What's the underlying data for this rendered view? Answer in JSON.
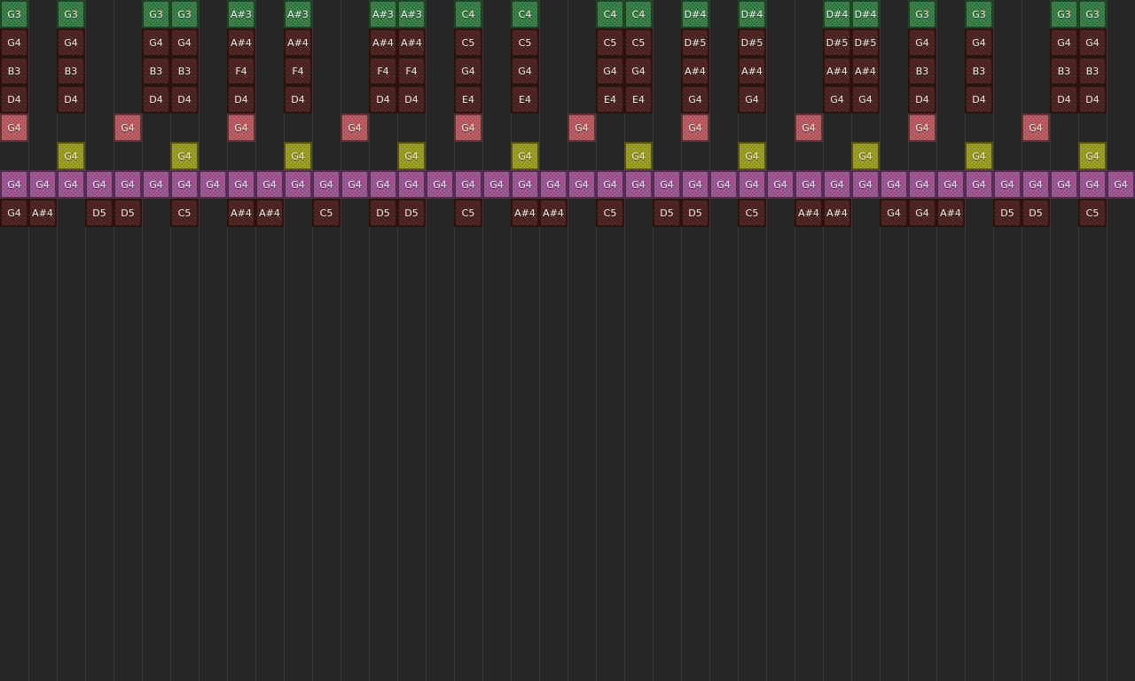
{
  "colors": {
    "background": "#262628",
    "divider": "#3c3c3e",
    "bass": "#2f7a3d",
    "chord": "#4a1e1a",
    "snare": "#b8555a",
    "kick": "#9a9a1a",
    "hat": "#9c4f92",
    "melody": "#4a1e1a"
  },
  "rows": [
    {
      "role": "bass",
      "notes": [
        "G3",
        "",
        "G3",
        "",
        "",
        "G3",
        "G3",
        "",
        "A#3",
        "",
        "A#3",
        "",
        "",
        "A#3",
        "A#3",
        "",
        "C4",
        "",
        "C4",
        "",
        "",
        "C4",
        "C4",
        "",
        "D#4",
        "",
        "D#4",
        "",
        "",
        "D#4",
        "D#4",
        "",
        "G3",
        "",
        "G3",
        "",
        "",
        "G3",
        "G3",
        ""
      ]
    },
    {
      "role": "chord",
      "notes": [
        "G4",
        "",
        "G4",
        "",
        "",
        "G4",
        "G4",
        "",
        "A#4",
        "",
        "A#4",
        "",
        "",
        "A#4",
        "A#4",
        "",
        "C5",
        "",
        "C5",
        "",
        "",
        "C5",
        "C5",
        "",
        "D#5",
        "",
        "D#5",
        "",
        "",
        "D#5",
        "D#5",
        "",
        "G4",
        "",
        "G4",
        "",
        "",
        "G4",
        "G4",
        ""
      ]
    },
    {
      "role": "chord",
      "notes": [
        "B3",
        "",
        "B3",
        "",
        "",
        "B3",
        "B3",
        "",
        "F4",
        "",
        "F4",
        "",
        "",
        "F4",
        "F4",
        "",
        "G4",
        "",
        "G4",
        "",
        "",
        "G4",
        "G4",
        "",
        "A#4",
        "",
        "A#4",
        "",
        "",
        "A#4",
        "A#4",
        "",
        "B3",
        "",
        "B3",
        "",
        "",
        "B3",
        "B3",
        ""
      ]
    },
    {
      "role": "chord",
      "notes": [
        "D4",
        "",
        "D4",
        "",
        "",
        "D4",
        "D4",
        "",
        "D4",
        "",
        "D4",
        "",
        "",
        "D4",
        "D4",
        "",
        "E4",
        "",
        "E4",
        "",
        "",
        "E4",
        "E4",
        "",
        "G4",
        "",
        "G4",
        "",
        "",
        "G4",
        "G4",
        "",
        "D4",
        "",
        "D4",
        "",
        "",
        "D4",
        "D4",
        ""
      ]
    },
    {
      "role": "snare",
      "notes": [
        "G4",
        "",
        "",
        "",
        "G4",
        "",
        "",
        "",
        "G4",
        "",
        "",
        "",
        "G4",
        "",
        "",
        "",
        "G4",
        "",
        "",
        "",
        "G4",
        "",
        "",
        "",
        "G4",
        "",
        "",
        "",
        "G4",
        "",
        "",
        "",
        "G4",
        "",
        "",
        "",
        "G4",
        "",
        "",
        ""
      ]
    },
    {
      "role": "kick",
      "notes": [
        "",
        "",
        "G4",
        "",
        "",
        "",
        "G4",
        "",
        "",
        "",
        "G4",
        "",
        "",
        "",
        "G4",
        "",
        "",
        "",
        "G4",
        "",
        "",
        "",
        "G4",
        "",
        "",
        "",
        "G4",
        "",
        "",
        "",
        "G4",
        "",
        "",
        "",
        "G4",
        "",
        "",
        "",
        "G4",
        ""
      ]
    },
    {
      "role": "hat",
      "notes": [
        "G4",
        "G4",
        "G4",
        "G4",
        "G4",
        "G4",
        "G4",
        "G4",
        "G4",
        "G4",
        "G4",
        "G4",
        "G4",
        "G4",
        "G4",
        "G4",
        "G4",
        "G4",
        "G4",
        "G4",
        "G4",
        "G4",
        "G4",
        "G4",
        "G4",
        "G4",
        "G4",
        "G4",
        "G4",
        "G4",
        "G4",
        "G4",
        "G4",
        "G4",
        "G4",
        "G4",
        "G4",
        "G4",
        "G4",
        "G4"
      ]
    },
    {
      "role": "melody",
      "notes": [
        "G4",
        "A#4",
        "",
        "D5",
        "D5",
        "",
        "C5",
        "",
        "A#4",
        "A#4",
        "",
        "C5",
        "",
        "D5",
        "D5",
        "",
        "C5",
        "",
        "A#4",
        "A#4",
        "",
        "C5",
        "",
        "D5",
        "D5",
        "",
        "C5",
        "",
        "A#4",
        "A#4",
        "",
        "G4",
        "G4",
        "A#4",
        "",
        "D5",
        "D5",
        "",
        "C5",
        ""
      ]
    }
  ]
}
